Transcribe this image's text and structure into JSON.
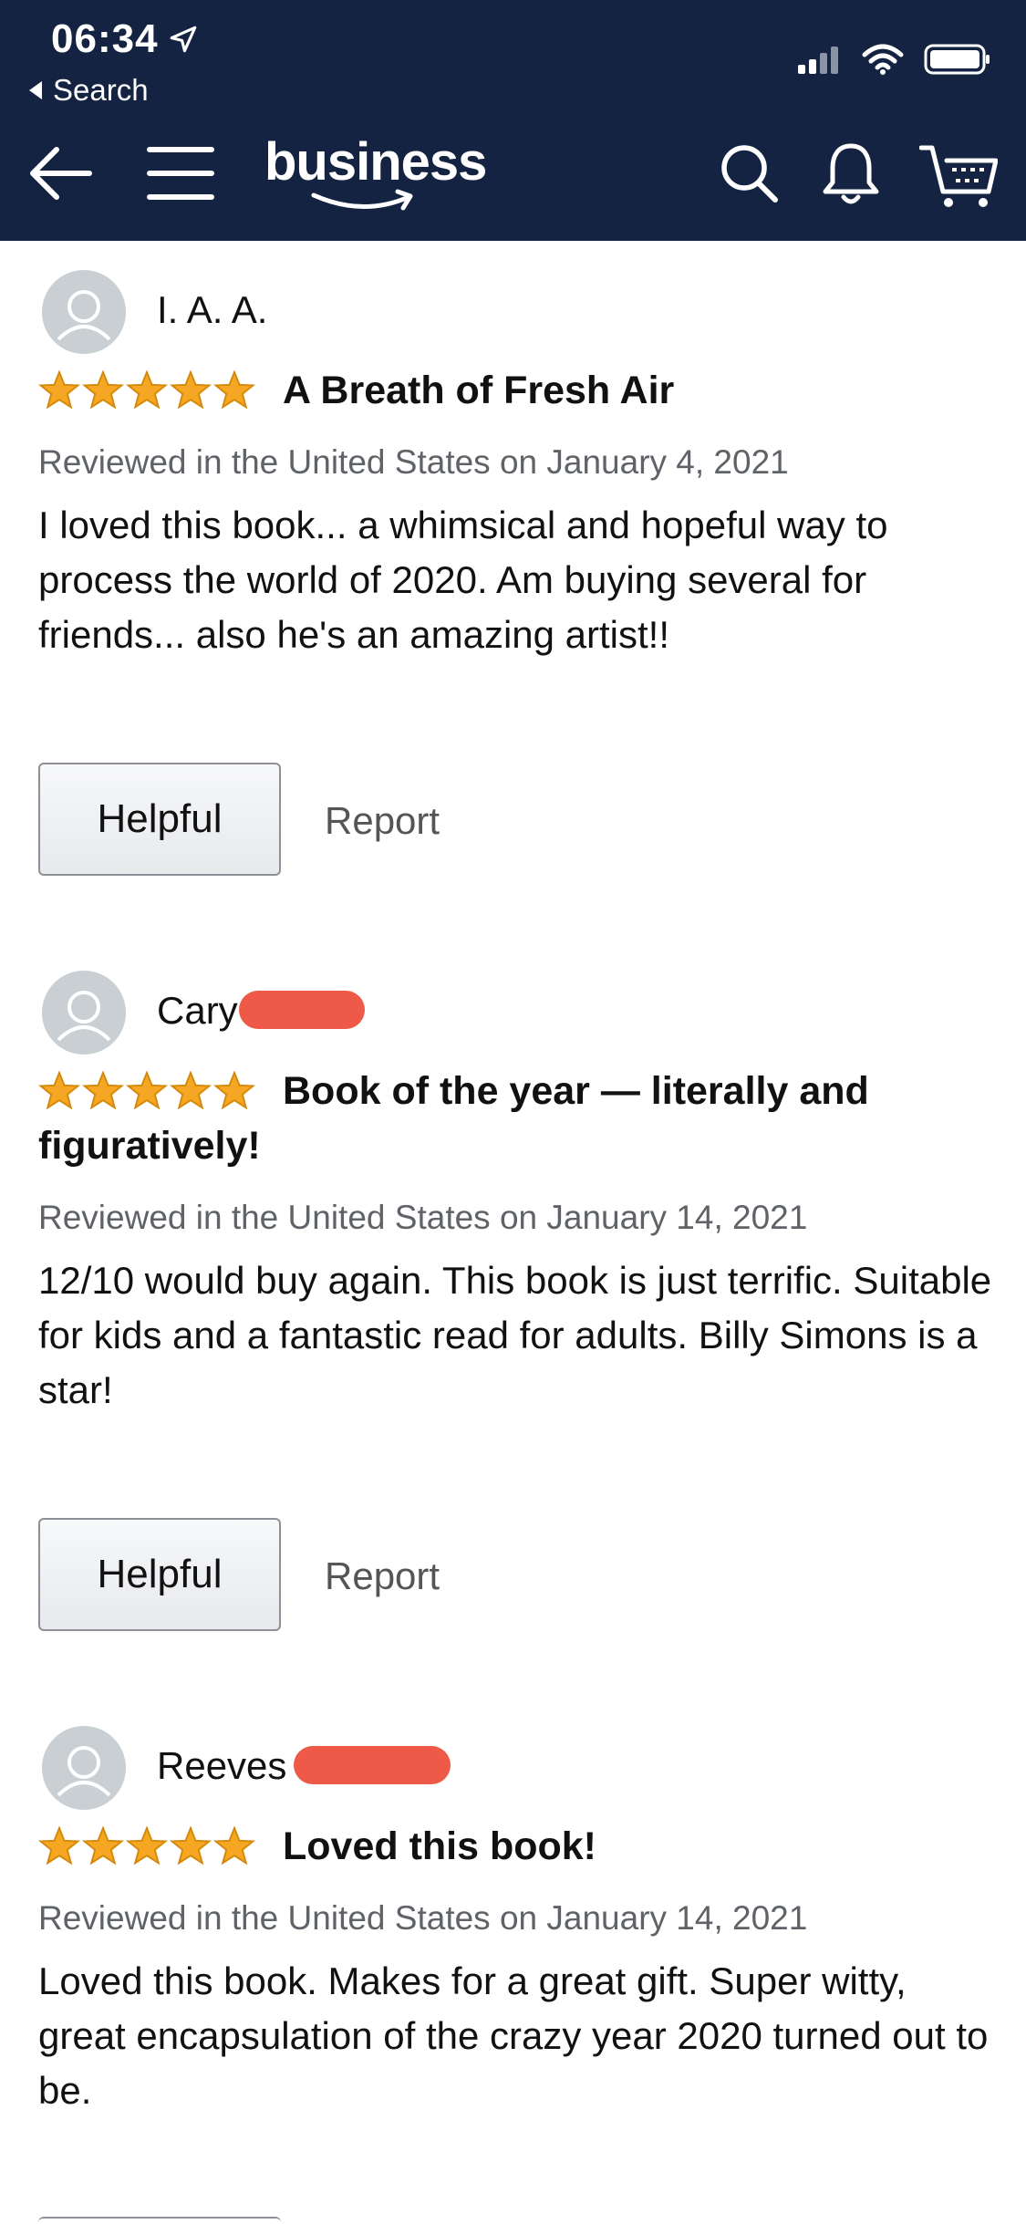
{
  "status_bar": {
    "time": "06:34",
    "back_label": "Search"
  },
  "nav": {
    "logo_text": "business",
    "icons": [
      "back-arrow-icon",
      "hamburger-menu-icon",
      "search-icon",
      "bell-icon",
      "cart-icon"
    ]
  },
  "colors": {
    "header_bg": "#132341",
    "star": "#f5a623",
    "redaction": "#ee5a47"
  },
  "reviews": [
    {
      "name": "I. A. A.",
      "rating": 5,
      "title": "A Breath of Fresh Air",
      "date": "Reviewed in the United States on January 4, 2021",
      "body": "I loved this book... a whimsical and hopeful way to process the world of 2020. Am buying several for friends... also he's an amazing artist!!",
      "helpful_label": "Helpful",
      "report_label": "Report"
    },
    {
      "name": "Cary",
      "rating": 5,
      "title": "Book of the year — literally and figuratively!",
      "date": "Reviewed in the United States on January 14, 2021",
      "body": "12/10 would buy again. This book is just terrific. Suitable for kids and a fantastic read for adults. Billy Simons is a star!",
      "helpful_label": "Helpful",
      "report_label": "Report"
    },
    {
      "name": "Reeves",
      "rating": 5,
      "title": "Loved this book!",
      "date": "Reviewed in the United States on January 14, 2021",
      "body": "Loved this book. Makes for a great gift. Super witty, great encapsulation of the crazy year 2020 turned out to be."
    }
  ]
}
